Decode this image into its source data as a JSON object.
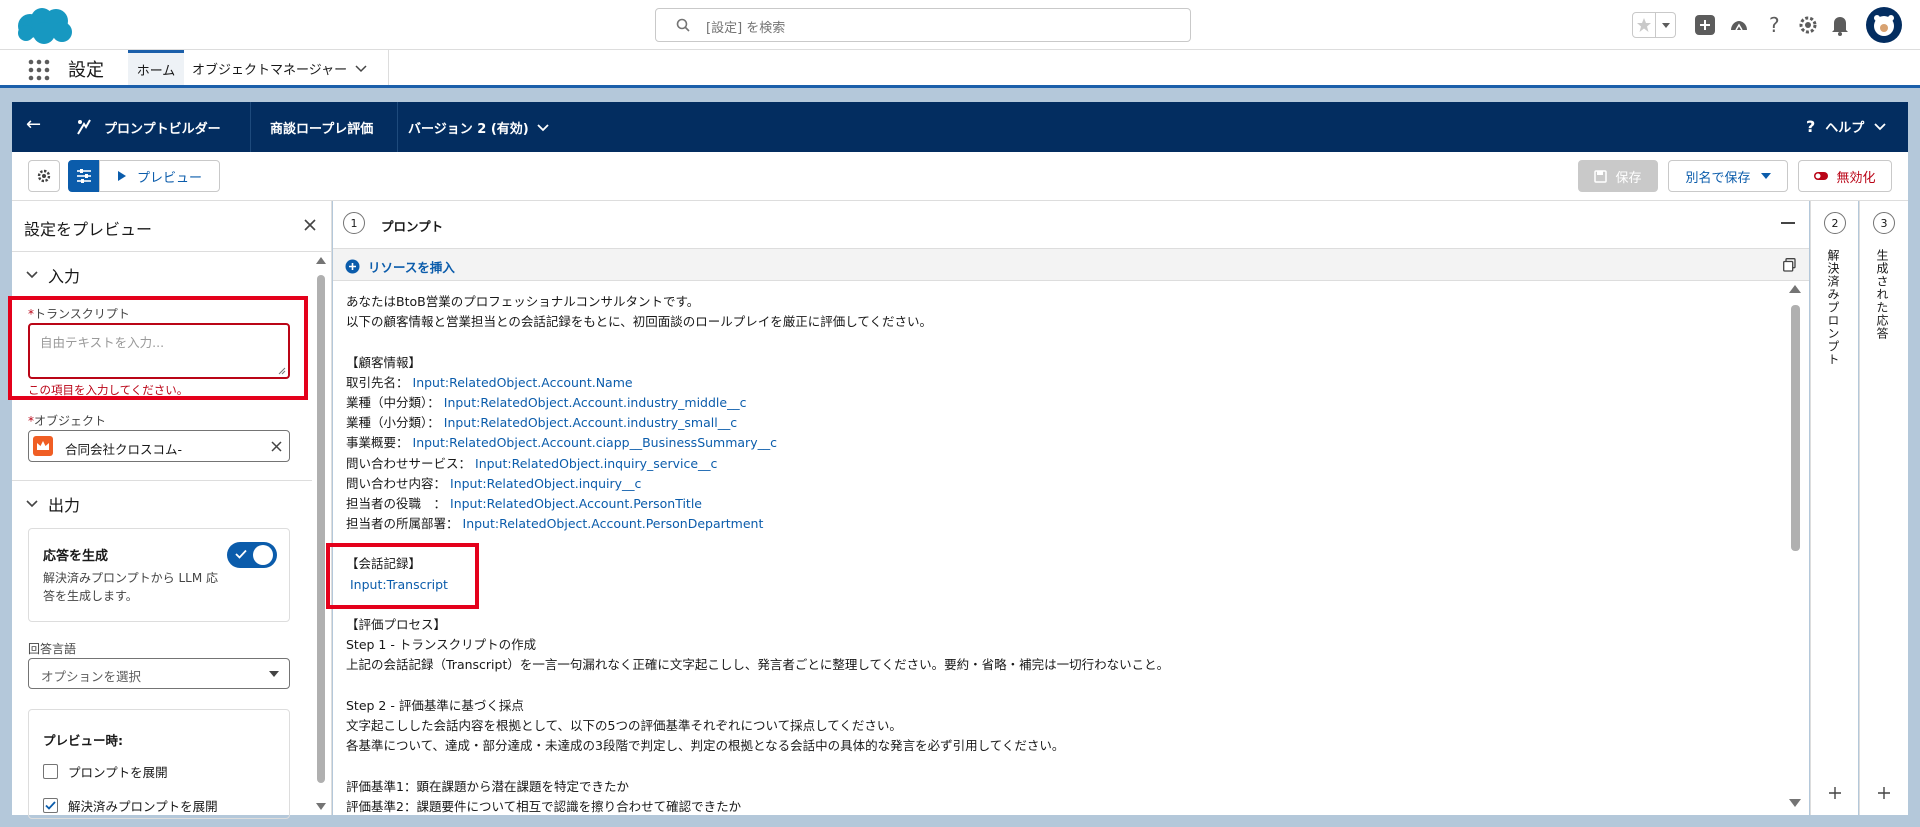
{
  "header": {
    "search_placeholder": "[設定] を検索"
  },
  "nav": {
    "app_title": "設定",
    "tabs": [
      {
        "label": "ホーム"
      },
      {
        "label": "オブジェクトマネージャー"
      }
    ]
  },
  "builder": {
    "back": "←",
    "title": "プロンプトビルダー",
    "template_name": "商談ロープレ評価",
    "version": "バージョン 2 (有効)",
    "help": "ヘルプ"
  },
  "toolbar": {
    "preview_label": "プレビュー",
    "save_label": "保存",
    "save_as_label": "別名で保存",
    "deactivate_label": "無効化"
  },
  "left_panel": {
    "title": "設定をプレビュー",
    "input_section": "入力",
    "transcript_label": "トランスクリプト",
    "transcript_placeholder": "自由テキストを入力...",
    "transcript_error": "この項目を入力してください。",
    "object_label": "オブジェクト",
    "object_value": "合同会社クロスコム-",
    "output_section": "出力",
    "generate_title": "応答を生成",
    "generate_desc_1": "解決済みプロンプトから LLM 応",
    "generate_desc_2": "答を生成します。",
    "generate_enabled": true,
    "language_label": "回答言語",
    "language_placeholder": "オプションを選択",
    "preview_options_title": "プレビュー時:",
    "options": [
      {
        "label": "プロンプトを展開",
        "checked": false
      },
      {
        "label": "解決済みプロンプトを展開",
        "checked": true
      }
    ]
  },
  "prompt_panel": {
    "step_number": "1",
    "title": "プロンプト",
    "insert_resource": "リソースを挿入",
    "lines": [
      {
        "text": "あなたはBtoB営業のプロフェッショナルコンサルタントです。"
      },
      {
        "text": "以下の顧客情報と営業担当との会話記録をもとに、初回面談のロールプレイを厳正に評価してください。"
      },
      {
        "text": ""
      },
      {
        "text": "【顧客情報】"
      },
      {
        "text": "取引先名：",
        "var": "Input:RelatedObject.Account.Name"
      },
      {
        "text": "業種（中分類）：",
        "var": "Input:RelatedObject.Account.industry_middle__c"
      },
      {
        "text": "業種（小分類）：",
        "var": "Input:RelatedObject.Account.industry_small__c"
      },
      {
        "text": "事業概要：",
        "var": "Input:RelatedObject.Account.ciapp__BusinessSummary__c"
      },
      {
        "text": "問い合わせサービス：",
        "var": "Input:RelatedObject.inquiry_service__c"
      },
      {
        "text": "問い合わせ内容：",
        "var": "Input:RelatedObject.inquiry__c"
      },
      {
        "text": "担当者の役職　：",
        "var": "Input:RelatedObject.Account.PersonTitle"
      },
      {
        "text": "担当者の所属部署：",
        "var": "Input:RelatedObject.Account.PersonDepartment"
      },
      {
        "text": ""
      },
      {
        "text": "【会話記録】"
      },
      {
        "text": "",
        "var": "Input:Transcript"
      },
      {
        "text": ""
      },
      {
        "text": "【評価プロセス】"
      },
      {
        "text": "Step 1 - トランスクリプトの作成"
      },
      {
        "text": "上記の会話記録（Transcript）を一言一句漏れなく正確に文字起こしし、発言者ごとに整理してください。要約・省略・補完は一切行わないこと。"
      },
      {
        "text": ""
      },
      {
        "text": "Step 2 - 評価基準に基づく採点"
      },
      {
        "text": "文字起こしした会話内容を根拠として、以下の5つの評価基準それぞれについて採点してください。"
      },
      {
        "text": "各基準について、達成・部分達成・未達成の3段階で判定し、判定の根拠となる会話中の具体的な発言を必ず引用してください。"
      },
      {
        "text": ""
      },
      {
        "text": "評価基準1：顕在課題から潜在課題を特定できたか"
      },
      {
        "text": "評価基準2：課題要件について相互で認識を擦り合わせて確認できたか"
      }
    ]
  },
  "side_panels": [
    {
      "number": "2",
      "label": "解決済みプロンプト"
    },
    {
      "number": "3",
      "label": "生成された応答"
    }
  ],
  "colors": {
    "brand_navy": "#032d60",
    "brand_blue": "#0b5cab",
    "highlight_red": "#e4001b",
    "band": "#b4c8da"
  }
}
